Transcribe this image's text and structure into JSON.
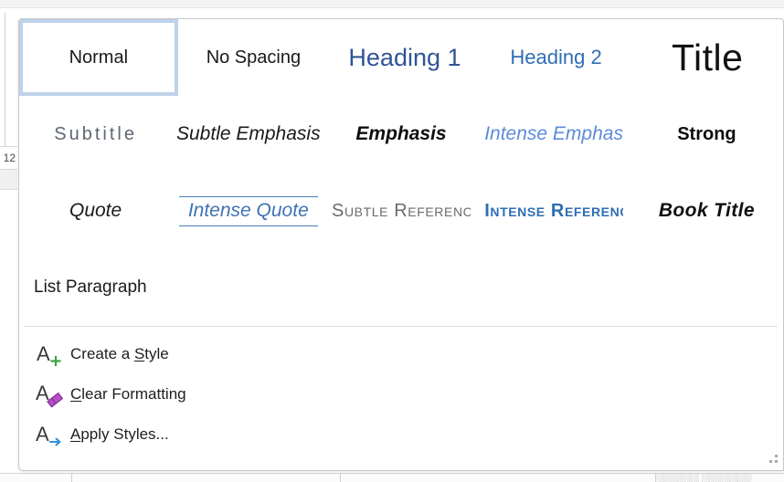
{
  "background": {
    "font_size_value": "12",
    "status_text": "░░░░░░ ░░░░░░░"
  },
  "panel": {
    "name": "styles-gallery-dropdown",
    "selection_border_color": "#bed3ea",
    "border_color": "#c6c6c6"
  },
  "gallery": {
    "rows": [
      [
        {
          "id": "normal",
          "label": "Normal",
          "selected": true,
          "align": "center"
        },
        {
          "id": "no-spacing",
          "label": "No Spacing",
          "selected": false,
          "align": "center"
        },
        {
          "id": "heading-1",
          "label": "Heading 1",
          "selected": false,
          "align": "center"
        },
        {
          "id": "heading-2",
          "label": "Heading 2",
          "selected": false,
          "align": "center"
        },
        {
          "id": "title",
          "label": "Title",
          "selected": false,
          "align": "center"
        }
      ],
      [
        {
          "id": "subtitle",
          "label": "Subtitle",
          "selected": false,
          "align": "center"
        },
        {
          "id": "subtle-emphasis",
          "label": "Subtle Emphasis",
          "selected": false,
          "align": "center"
        },
        {
          "id": "emphasis",
          "label": "Emphasis",
          "selected": false,
          "align": "center"
        },
        {
          "id": "intense-emphasis",
          "label": "Intense Emphasis",
          "selected": false,
          "align": "center"
        },
        {
          "id": "strong",
          "label": "Strong",
          "selected": false,
          "align": "center"
        }
      ],
      [
        {
          "id": "quote",
          "label": "Quote",
          "selected": false,
          "align": "center"
        },
        {
          "id": "intense-quote",
          "label": "Intense Quote",
          "selected": false,
          "align": "center"
        },
        {
          "id": "subtle-reference",
          "label": "Subtle Reference",
          "selected": false,
          "align": "center"
        },
        {
          "id": "intense-reference",
          "label": "Intense Reference",
          "selected": false,
          "align": "center"
        },
        {
          "id": "book-title",
          "label": "Book Title",
          "selected": false,
          "align": "center"
        }
      ],
      [
        {
          "id": "list-paragraph",
          "label": "List Paragraph",
          "selected": false,
          "align": "left"
        }
      ]
    ]
  },
  "menu": {
    "items": [
      {
        "id": "create-a-style",
        "icon": "letter-a-plus-icon",
        "pre": "Create a ",
        "accel": "S",
        "post": "tyle",
        "accent": "#3ea338"
      },
      {
        "id": "clear-formatting",
        "icon": "letter-a-eraser-icon",
        "pre": "",
        "accel": "C",
        "post": "lear Formatting",
        "accent": "#a33fa3"
      },
      {
        "id": "apply-styles",
        "icon": "letter-a-arrow-icon",
        "pre": "",
        "accel": "A",
        "post": "pply Styles...",
        "accent": "#2f8fd8"
      }
    ]
  }
}
